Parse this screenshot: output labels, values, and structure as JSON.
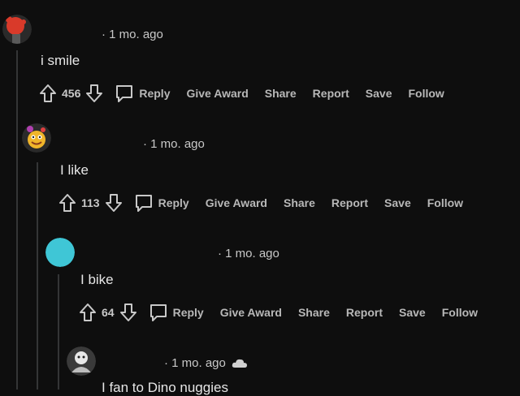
{
  "comments": [
    {
      "timestamp": "· 1 mo. ago",
      "body": "i smile",
      "votes": "456",
      "actions": {
        "reply": "Reply",
        "award": "Give Award",
        "share": "Share",
        "report": "Report",
        "save": "Save",
        "follow": "Follow"
      }
    },
    {
      "timestamp": "· 1 mo. ago",
      "body": "I like",
      "votes": "113",
      "actions": {
        "reply": "Reply",
        "award": "Give Award",
        "share": "Share",
        "report": "Report",
        "save": "Save",
        "follow": "Follow"
      }
    },
    {
      "timestamp": "· 1 mo. ago",
      "body": "I bike",
      "votes": "64",
      "actions": {
        "reply": "Reply",
        "award": "Give Award",
        "share": "Share",
        "report": "Report",
        "save": "Save",
        "follow": "Follow"
      }
    },
    {
      "timestamp": "· 1 mo. ago",
      "body": "I fan to Dino nuggies"
    }
  ],
  "colors": {
    "background": "#0e0e0e",
    "thread_line": "#343536",
    "text": "#d7dadc",
    "muted": "#b8b8b8",
    "avatar_red": "#d93a2a",
    "avatar_cyan": "#3fc6d6",
    "avatar_yellow": "#f0b52a"
  },
  "icons": [
    "upvote-arrow-icon",
    "downvote-arrow-icon",
    "comment-bubble-icon",
    "cloud-icon"
  ]
}
